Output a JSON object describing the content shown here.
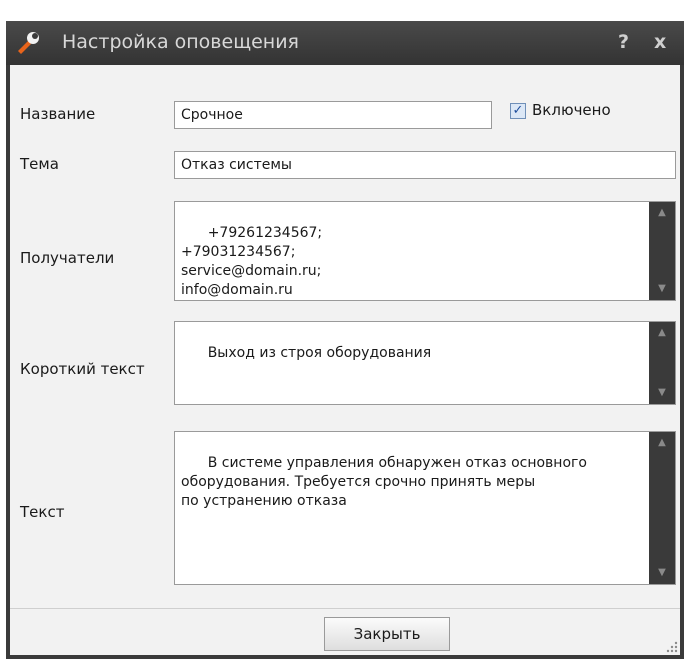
{
  "window": {
    "title": "Настройка оповещения",
    "help_label": "?",
    "close_label": "x"
  },
  "form": {
    "name_label": "Название",
    "name_value": "Срочное",
    "enabled_label": "Включено",
    "enabled_checked": true,
    "subject_label": "Тема",
    "subject_value": "Отказ системы",
    "recipients_label": "Получатели",
    "recipients_value": "+79261234567;\n+79031234567;\nservice@domain.ru;\ninfo@domain.ru",
    "short_text_label": "Короткий текст",
    "short_text_value": "Выход из строя оборудования",
    "text_label": "Текст",
    "text_value": "В системе управления обнаружен отказ основного\nоборудования. Требуется срочно принять меры\nпо устранению отказа"
  },
  "footer": {
    "close_button_label": "Закрыть"
  },
  "colors": {
    "window_frame": "#3a3a3a",
    "client_background": "#f2f2f2",
    "icon_orange": "#e8641b"
  }
}
